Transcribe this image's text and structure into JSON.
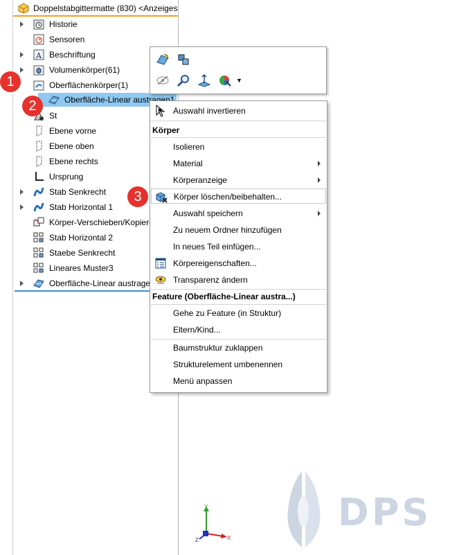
{
  "tree": {
    "header": "Doppelstabgittermatte (830) <Anzeigest",
    "items": [
      {
        "label": "Historie",
        "icon": "history-folder-icon"
      },
      {
        "label": "Sensoren",
        "icon": "sensor-icon"
      },
      {
        "label": "Beschriftung",
        "icon": "annotation-icon"
      },
      {
        "label": "Volumenkörper(61)",
        "icon": "solid-bodies-folder-icon"
      },
      {
        "label": "Oberflächenkörper(1)",
        "icon": "surface-bodies-folder-icon"
      },
      {
        "label": "Oberfläche-Linear austragen1",
        "icon": "surface-pattern-icon"
      },
      {
        "label": "St",
        "icon": "material-icon"
      },
      {
        "label": "Ebene vorne",
        "icon": "plane-icon"
      },
      {
        "label": "Ebene oben",
        "icon": "plane-icon"
      },
      {
        "label": "Ebene rechts",
        "icon": "plane-icon"
      },
      {
        "label": "Ursprung",
        "icon": "origin-icon"
      },
      {
        "label": "Stab Senkrecht",
        "icon": "sweep-icon"
      },
      {
        "label": "Stab Horizontal 1",
        "icon": "sweep-icon"
      },
      {
        "label": "Körper-Verschieben/Kopiere",
        "icon": "move-copy-icon"
      },
      {
        "label": "Stab Horizontal 2",
        "icon": "pattern-icon"
      },
      {
        "label": "Staebe Senkrecht",
        "icon": "pattern-icon"
      },
      {
        "label": "Lineares Muster3",
        "icon": "pattern-icon"
      },
      {
        "label": "Oberfläche-Linear austragen",
        "icon": "surface-pattern-icon"
      }
    ]
  },
  "context_menu": {
    "first_item": "Auswahl invertieren",
    "section_koerper": "Körper",
    "koerper_items": [
      {
        "label": "Isolieren",
        "submenu": false
      },
      {
        "label": "Material",
        "submenu": true
      },
      {
        "label": "Körperanzeige",
        "submenu": true
      },
      {
        "label": "Körper löschen/beibehalten...",
        "submenu": false
      },
      {
        "label": "Auswahl speichern",
        "submenu": true
      },
      {
        "label": "Zu neuem Ordner hinzufügen",
        "submenu": false
      },
      {
        "label": "In neues Teil einfügen...",
        "submenu": false
      },
      {
        "label": "Körpereigenschaften...",
        "submenu": false
      },
      {
        "label": "Transparenz ändern",
        "submenu": false
      }
    ],
    "section_feature": "Feature (Oberfläche-Linear austra...)",
    "feature_items": [
      {
        "label": "Gehe zu Feature (in Struktur)"
      },
      {
        "label": "Eltern/Kind..."
      }
    ],
    "tree_items": [
      {
        "label": "Baumstruktur zuklappen"
      },
      {
        "label": "Strukturelement umbenennen"
      },
      {
        "label": "Menü anpassen"
      }
    ]
  },
  "badges": [
    "1",
    "2",
    "3"
  ],
  "triad": {
    "y": "Y",
    "x": "X",
    "z": "Z"
  },
  "watermark": "DPS",
  "colors": {
    "badge": "#e5322d",
    "selection": "#8fc8f0",
    "header_underline": "#f0a020",
    "divider": "#3a8ed4"
  }
}
